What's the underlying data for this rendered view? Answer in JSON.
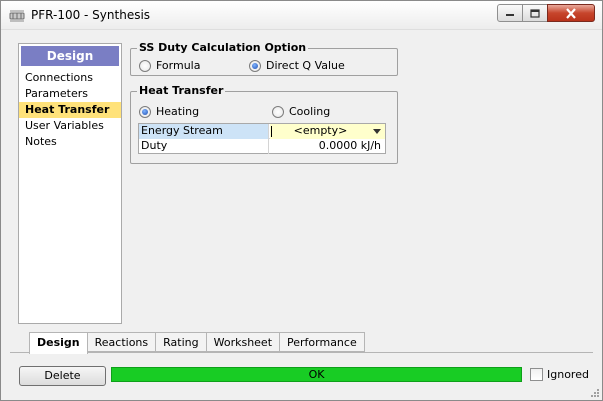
{
  "window": {
    "title": "PFR-100 - Synthesis",
    "icon": "reactor-icon"
  },
  "nav": {
    "header": "Design",
    "items": [
      {
        "label": "Connections",
        "active": false
      },
      {
        "label": "Parameters",
        "active": false
      },
      {
        "label": "Heat Transfer",
        "active": true
      },
      {
        "label": "User Variables",
        "active": false
      },
      {
        "label": "Notes",
        "active": false
      }
    ]
  },
  "duty_option": {
    "title": "SS Duty Calculation Option",
    "formula_label": "Formula",
    "direct_label": "Direct Q Value",
    "selected": "Direct Q Value"
  },
  "heat_transfer": {
    "title": "Heat Transfer",
    "heating_label": "Heating",
    "cooling_label": "Cooling",
    "selected": "Heating",
    "rows": [
      {
        "label": "Energy Stream",
        "value": "<empty>"
      },
      {
        "label": "Duty",
        "value": "0.0000 kJ/h"
      }
    ]
  },
  "tabs": [
    {
      "label": "Design",
      "active": true
    },
    {
      "label": "Reactions",
      "active": false
    },
    {
      "label": "Rating",
      "active": false
    },
    {
      "label": "Worksheet",
      "active": false
    },
    {
      "label": "Performance",
      "active": false
    }
  ],
  "footer": {
    "delete_label": "Delete",
    "status": "OK",
    "status_color": "#18cc24",
    "ignored_label": "Ignored",
    "ignored_checked": false
  },
  "colors": {
    "nav_header": "#7a7ec4",
    "nav_active": "#ffe27a",
    "label_cell": "#cde3f7",
    "input_cell": "#ffffcc"
  }
}
